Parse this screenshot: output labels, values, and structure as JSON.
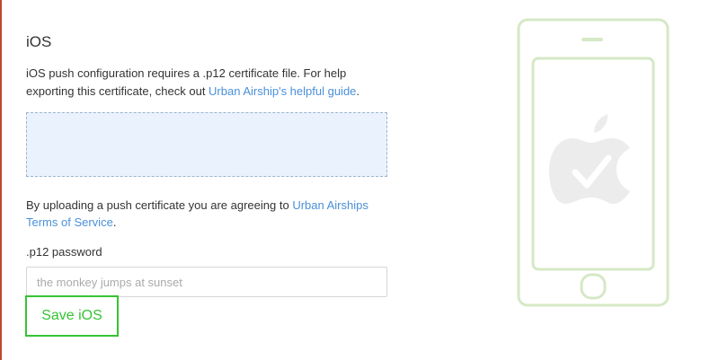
{
  "section": {
    "title": "iOS",
    "description": "iOS push configuration requires a .p12 certificate file. For help exporting this certificate, check out ",
    "guide_link": "Urban Airship's helpful guide",
    "description_end": "."
  },
  "terms": {
    "text": "By uploading a push certificate you are agreeing to ",
    "link": "Urban Airships Terms of Service",
    "end": "."
  },
  "password": {
    "label": ".p12 password",
    "placeholder": "the monkey jumps at sunset",
    "value": ""
  },
  "save_button": {
    "label": "Save iOS"
  },
  "illustration": {
    "icon": "phone-apple-check-icon"
  },
  "colors": {
    "accent_green": "#35c435",
    "link_blue": "#4a90d9",
    "dropzone_bg": "#eaf3fd",
    "phone_outline": "#d6e8c6",
    "left_rule": "#c0492f"
  }
}
